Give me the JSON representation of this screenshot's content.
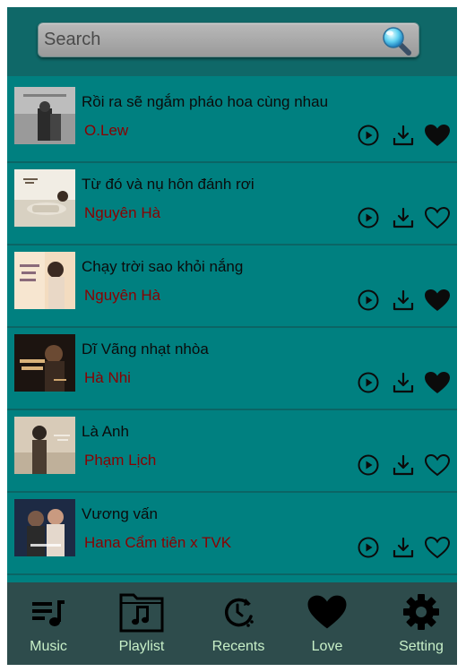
{
  "search": {
    "placeholder": "Search",
    "value": ""
  },
  "songs": [
    {
      "title": "Rồi ra sẽ ngắm pháo hoa cùng nhau",
      "artist": "O.Lew",
      "liked": true
    },
    {
      "title": "Từ đó và nụ hôn đánh rơi",
      "artist": "Nguyên Hà",
      "liked": false
    },
    {
      "title": "Chạy trời sao khỏi nắng",
      "artist": "Nguyên Hà",
      "liked": true
    },
    {
      "title": "Dĩ Vãng nhạt nhòa",
      "artist": "Hà Nhi",
      "liked": true
    },
    {
      "title": "Là Anh",
      "artist": "Phạm Lịch",
      "liked": false
    },
    {
      "title": "Vương vấn",
      "artist": "Hana Cẩm tiên x TVK",
      "liked": false
    }
  ],
  "nav": {
    "tabs": [
      {
        "label": "Music",
        "icon": "music-list-icon"
      },
      {
        "label": "Playlist",
        "icon": "playlist-icon"
      },
      {
        "label": "Recents",
        "icon": "recents-icon"
      },
      {
        "label": "Love",
        "icon": "heart-icon"
      },
      {
        "label": "Setting",
        "icon": "gear-icon"
      }
    ]
  },
  "colors": {
    "background": "#008080",
    "header": "#0f6868",
    "nav": "#2e4c4c",
    "artist": "#8b0000",
    "nav_label": "#c8f0c8"
  }
}
